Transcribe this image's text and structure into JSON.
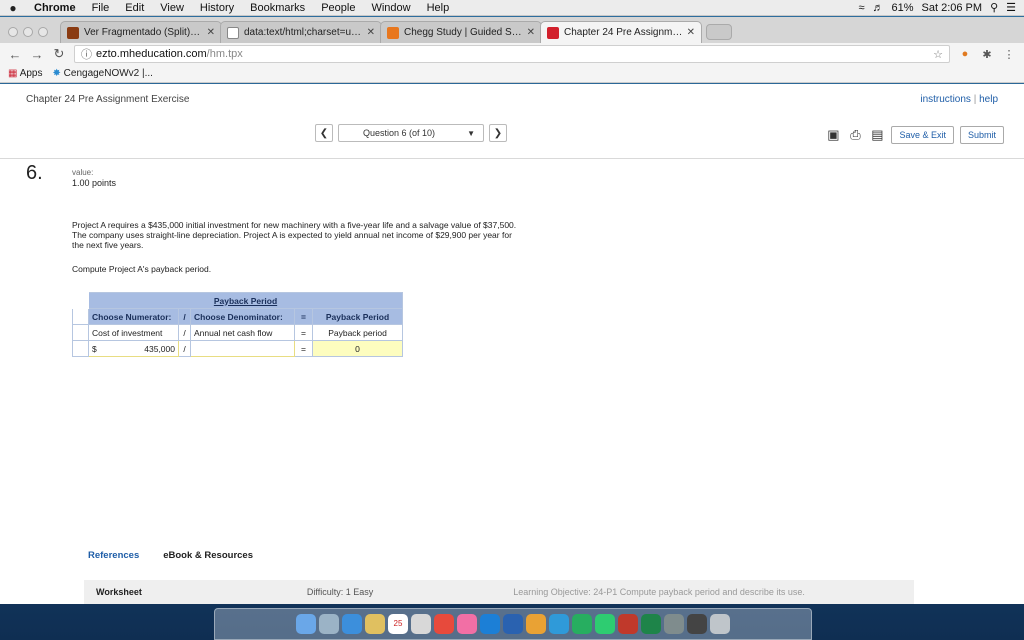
{
  "menubar": {
    "items": [
      "Chrome",
      "File",
      "Edit",
      "View",
      "History",
      "Bookmarks",
      "People",
      "Window",
      "Help"
    ],
    "battery": "61%",
    "clock": "Sat 2:06 PM"
  },
  "tabs": [
    {
      "label": "Ver Fragmentado (Split) (201",
      "color": "#8a3b12"
    },
    {
      "label": "data:text/html;charset=utf-8",
      "color": "#ffffff"
    },
    {
      "label": "Chegg Study | Guided Solution",
      "color": "#e8771e"
    },
    {
      "label": "Chapter 24 Pre Assignment E",
      "color": "#d2202c"
    }
  ],
  "address": {
    "host": "ezto.mheducation.com",
    "path": "/hm.tpx"
  },
  "bookmarks": {
    "apps": "Apps",
    "item1": "CengageNOWv2 |..."
  },
  "page": {
    "title": "Chapter 24 Pre Assignment Exercise",
    "instructions": "instructions",
    "help_sep": "|",
    "help": "help",
    "question_select": "Question 6 (of 10)",
    "save_exit": "Save & Exit",
    "submit": "Submit",
    "question_number": "6.",
    "value_label": "value:",
    "value": "1.00 points",
    "problem_text": "Project A requires a $435,000 initial investment for new machinery with a five-year life and a salvage value of $37,500. The company uses straight-line depreciation. Project A is expected to yield annual net income of $29,900 per year for the next five years.",
    "instruction": "Compute Project A's payback period."
  },
  "table": {
    "title": "Payback Period",
    "headers": {
      "numerator": "Choose Numerator:",
      "slash": "/",
      "denominator": "Choose Denominator:",
      "equals": "=",
      "result": "Payback Period"
    },
    "row1": {
      "numerator": "Cost of investment",
      "slash": "/",
      "denominator": "Annual net cash flow",
      "equals": "=",
      "result": "Payback period"
    },
    "row2": {
      "currency": "$",
      "numerator": "435,000",
      "slash": "/",
      "denominator": "",
      "equals": "=",
      "result": "0"
    }
  },
  "bottom": {
    "references": "References",
    "ebook": "eBook & Resources",
    "worksheet": "Worksheet",
    "difficulty": "Difficulty: 1 Easy",
    "objective": "Learning Objective: 24-P1 Compute payback period and describe its use."
  },
  "dock_calendar": "25"
}
